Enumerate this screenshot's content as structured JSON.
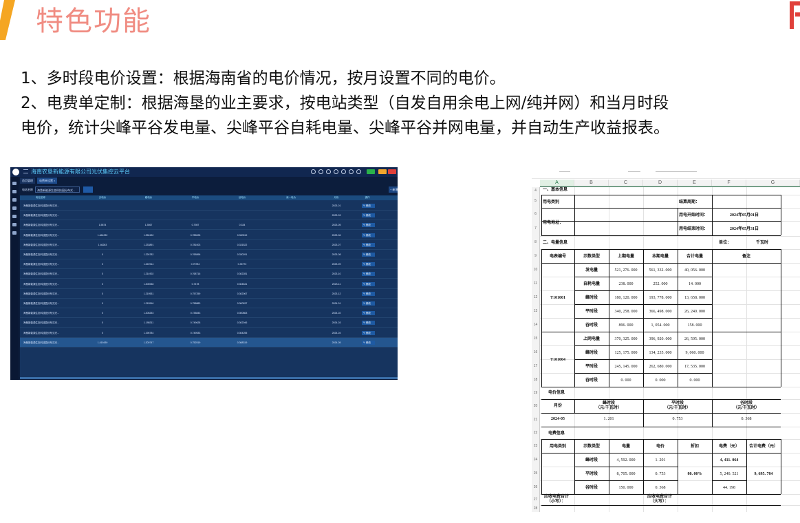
{
  "slide": {
    "title": "特色功能",
    "accent_color": "#f08c82",
    "bullets": [
      "1、多时段电价设置：根据海南省的电价情况，按月设置不同的电价。",
      "2、电费单定制：根据海垦的业主要求，按电站类型（自发自用余电上网/纯并网）和当月时段",
      "电价，统计尖峰平谷发电量、尖峰平谷自耗电量、尖峰平谷并网电量，并自动生产收益报表。"
    ]
  },
  "dashboard": {
    "title": "海南农垦新能源有限公司光伏集控云平台",
    "tabs": [
      "首页管理",
      "电费单设置 ×"
    ],
    "filter_label": "电站名称",
    "filter_value": "海垦新能源生态科技园分布式...",
    "add_label": "+ 新增",
    "columns": [
      "电站名称",
      "尖电价",
      "峰电价",
      "平电价",
      "谷电价",
      "深—电价",
      "月份",
      "操作"
    ],
    "op_label": "修改",
    "rows": [
      {
        "name": "海垦新能源生态科技园分布式光...",
        "jian": "",
        "feng": "",
        "ping": "",
        "gu": "",
        "month": "2023-01"
      },
      {
        "name": "海垦新能源生态科技园分布式光...",
        "jian": "",
        "feng": "",
        "ping": "",
        "gu": "",
        "month": "2023-03"
      },
      {
        "name": "海垦新能源生态科技园分布式光...",
        "jian": "1.5874",
        "feng": "1.3567",
        "ping": "0.7987",
        "gu": "0.334",
        "month": "2023-05"
      },
      {
        "name": "海垦新能源生态科技园分布式光...",
        "jian": "1.464232",
        "feng": "1.256132",
        "ping": "0.785028",
        "gu": "0.330519",
        "month": "2023-06"
      },
      {
        "name": "海垦新能源生态科技园分布式光...",
        "jian": "1.46263",
        "feng": "1.233891",
        "ping": "0.781003",
        "gu": "0.331522",
        "month": "2023-07"
      },
      {
        "name": "海垦新能源生态科技园分布式光...",
        "jian": "0",
        "feng": "1.226782",
        "ping": "0.765896",
        "gu": "0.330291",
        "month": "2023-08"
      },
      {
        "name": "海垦新能源生态科技园分布式光...",
        "jian": "0",
        "feng": "1.222914",
        "ping": "0.75784",
        "gu": "0.33772",
        "month": "2023-09"
      },
      {
        "name": "海垦新能源生态科技园分布式光...",
        "jian": "0",
        "feng": "1.214902",
        "ping": "0.768716",
        "gu": "0.302281",
        "month": "2023-10"
      },
      {
        "name": "海垦新能源生态科技园分布式光...",
        "jian": "0",
        "feng": "1.206948",
        "ping": "0.7478",
        "gu": "0.304841",
        "month": "2023-11"
      },
      {
        "name": "海垦新能源生态科技园分布式光...",
        "jian": "0",
        "feng": "1.219531",
        "ping": "0.757259",
        "gu": "0.302067",
        "month": "2023-12"
      },
      {
        "name": "海垦新能源生态科技园分布式光...",
        "jian": "0",
        "feng": "1.215516",
        "ping": "0.758883",
        "gu": "0.300537",
        "month": "2024-01"
      },
      {
        "name": "海垦新能源生态科技园分布式光...",
        "jian": "0",
        "feng": "1.206253",
        "ping": "0.735843",
        "gu": "0.300863",
        "month": "2024-02"
      },
      {
        "name": "海垦新能源生态科技园分布式光...",
        "jian": "0",
        "feng": "1.198311",
        "ping": "0.749628",
        "gu": "0.302046",
        "month": "2024-03"
      },
      {
        "name": "海垦新能源生态科技园分布式光...",
        "jian": "0",
        "feng": "1.196784",
        "ping": "0.749533",
        "gu": "0.304255",
        "month": "2024-04"
      },
      {
        "name": "海垦新能源生态科技园分布式光...",
        "jian": "1.419439",
        "feng": "1.200747",
        "ping": "0.752519",
        "gu": "0.368319",
        "month": "2024-05"
      }
    ]
  },
  "sheet": {
    "col_headers": [
      "A",
      "B",
      "C",
      "D",
      "E",
      "F",
      "G"
    ],
    "row_numbers": [
      "4",
      "5",
      "6",
      "7",
      "8",
      "9",
      "10",
      "11",
      "12",
      "13",
      "14",
      "15",
      "16",
      "17",
      "18",
      "19",
      "20",
      "21",
      "22",
      "23",
      "24",
      "25",
      "26",
      "27",
      "28"
    ],
    "section_basic": "一、基本信息",
    "label_usage_type": "用电类别",
    "label_period": "结算周期：",
    "label_address": "用电地址：",
    "label_start": "用电开始时间：",
    "start_date": "2024年05月01日",
    "label_end": "用电结束时间：",
    "end_date": "2024年05月31日",
    "section_energy": "二、电量信息",
    "unit_label": "单位：",
    "unit_value": "千瓦时",
    "energy_headers": [
      "电表编号",
      "示数类型",
      "上期电量",
      "本期电量",
      "合计电量",
      "备注"
    ],
    "meter1": "T101001",
    "meter1_rows": [
      {
        "type": "发电量",
        "prev": "521, 276. 000",
        "curr": "561, 332. 000",
        "total": "40, 056. 000"
      },
      {
        "type": "自耗电量",
        "prev": "238. 000",
        "curr": "252. 000",
        "total": "14. 000"
      },
      {
        "type": "峰时段",
        "prev": "180, 120. 000",
        "curr": "193, 778. 000",
        "total": "13, 658. 000"
      },
      {
        "type": "平时段",
        "prev": "340, 258. 000",
        "curr": "366, 498. 000",
        "total": "26, 240. 000"
      },
      {
        "type": "谷时段",
        "prev": "896. 000",
        "curr": "1, 054. 000",
        "total": "158. 000"
      }
    ],
    "meter2": "T101004",
    "meter2_rows": [
      {
        "type": "上网电量",
        "prev": "370, 325. 000",
        "curr": "396, 920. 000",
        "total": "26, 595. 000"
      },
      {
        "type": "峰时段",
        "prev": "125, 175. 000",
        "curr": "134, 235. 000",
        "total": "9, 060. 000"
      },
      {
        "type": "平时段",
        "prev": "245, 145. 000",
        "curr": "262, 680. 000",
        "total": "17, 535. 000"
      },
      {
        "type": "谷时段",
        "prev": "0. 000",
        "curr": "0. 000",
        "total": "0. 000"
      }
    ],
    "section_price": "电价信息",
    "price_month_label": "月份",
    "price_headers": [
      {
        "name": "峰时段",
        "unit": "（元/千瓦时）"
      },
      {
        "name": "平时段",
        "unit": "（元/千瓦时）"
      },
      {
        "name": "谷时段",
        "unit": "（元/千瓦时）"
      }
    ],
    "price_month": "2024-05",
    "price_values": [
      "1. 201",
      "0. 753",
      "0. 368"
    ],
    "section_fee": "电费信息",
    "fee_headers": [
      "用电类别",
      "示数类型",
      "电量",
      "电价",
      "折扣",
      "电费（元）",
      "合计电费（元）"
    ],
    "fee_rows": [
      {
        "type": "峰时段",
        "qty": "4, 592. 000",
        "price": "1. 201",
        "fee": "4, 411. 064"
      },
      {
        "type": "平时段",
        "qty": "8, 705. 000",
        "price": "0. 753",
        "fee": "5, 240. 521"
      },
      {
        "type": "谷时段",
        "qty": "150. 000",
        "price": "0. 368",
        "fee": "44. 198"
      }
    ],
    "discount": "80. 00%",
    "fee_total": "9, 695. 784",
    "receivable_small_1": "应收电费合计",
    "receivable_small_2": "（小写）：",
    "receivable_big_1": "应收电费合计",
    "receivable_big_2": "（大写）："
  }
}
